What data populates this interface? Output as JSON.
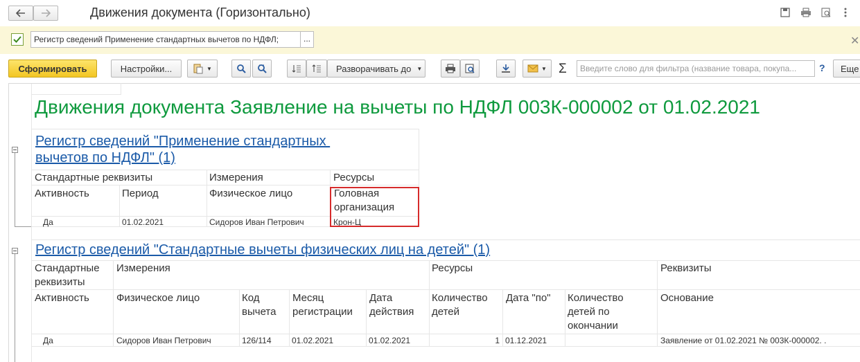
{
  "window": {
    "title": "Движения документа (Горизонтально)"
  },
  "filter_bar": {
    "value": "Регистр сведений Применение стандартных вычетов по НДФЛ;",
    "more_label": "..."
  },
  "toolbar": {
    "generate_label": "Сформировать",
    "settings_label": "Настройки...",
    "expand_label": "Разворачивать до",
    "search_placeholder": "Введите слово для фильтра (название товара, покупа...",
    "help_label": "?",
    "more_label": "Еще",
    "sigma": "Σ"
  },
  "report": {
    "title": "Движения документа Заявление на вычеты по НДФЛ 003К-000002 от 01.02.2021",
    "register1": {
      "title_line1": "Регистр сведений \"Применение стандартных ",
      "title_line2": "вычетов по НДФЛ\" (1)",
      "groups": [
        "Стандартные реквизиты",
        "Измерения",
        "Ресурсы"
      ],
      "columns": [
        "Активность",
        "Период",
        "Физическое лицо",
        "Головная организация"
      ],
      "row": [
        "Да",
        "01.02.2021",
        "Сидоров Иван Петрович",
        "Крон-Ц"
      ]
    },
    "register2": {
      "title": "Регистр сведений \"Стандартные вычеты физических лиц на детей\" (1)",
      "groups": [
        "Стандартные реквизиты",
        "Измерения",
        "Ресурсы",
        "Реквизиты"
      ],
      "columns": [
        "Активность",
        "Физическое лицо",
        "Код вычета",
        "Месяц регистрации",
        "Дата действия",
        "Количество детей",
        "Дата \"по\"",
        "Количество детей по окончании",
        "Основание"
      ],
      "row": [
        "Да",
        "Сидоров Иван Петрович",
        "126/114",
        "01.02.2021",
        "01.02.2021",
        "1",
        "01.12.2021",
        "",
        "Заявление от 01.02.2021 № 003К-000002. ."
      ]
    }
  },
  "colors": {
    "title_green": "#0f9a3e",
    "link_blue": "#1a5aa8",
    "highlight_red": "#d62b2b",
    "generate_yellow": "#f7d33b"
  }
}
